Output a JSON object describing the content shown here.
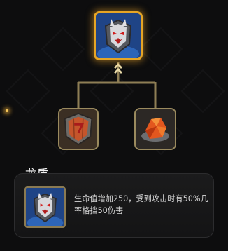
{
  "tree": {
    "top_item": {
      "name": "dragon-shield",
      "icon": "dragon-shield-icon",
      "selected": true,
      "frame_color": "#e6a525"
    },
    "children": [
      {
        "icon": "wooden-shield-icon",
        "frame_color": "#9a8a5e"
      },
      {
        "icon": "orange-crystal-icon",
        "frame_color": "#9a8a5e"
      }
    ]
  },
  "info": {
    "title": "龙盾",
    "icon": "dragon-shield-icon",
    "description": "生命值增加250，受到攻击时有50%几率格挡50伤害"
  }
}
